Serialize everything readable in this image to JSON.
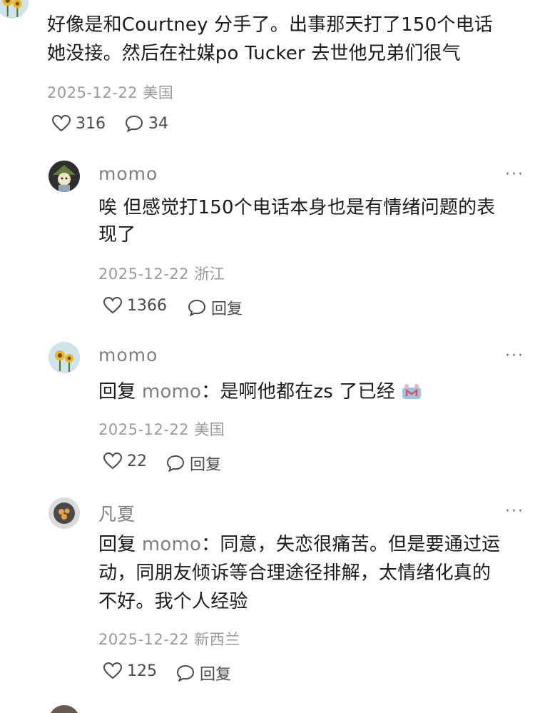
{
  "top_comment": {
    "text_line1": "好像是和Courtney 分手了。出事那天打了150个电话",
    "text_line2": "她没接。然后在社媒po Tucker 去世他兄弟们很气",
    "date": "2025-12-22",
    "location": "美国",
    "likes": "316",
    "comments": "34"
  },
  "replies": [
    {
      "name": "momo",
      "text_line1": "唉 但感觉打150个电话本身也是有情绪问题的表",
      "text_line2": "现了",
      "date": "2025-12-22",
      "location": "浙江",
      "likes": "1366",
      "reply_label": "回复",
      "more": "···"
    },
    {
      "name": "momo",
      "reply_prefix": "回复 ",
      "mention": "momo",
      "text_line1": "：是啊他都在zs 了已经",
      "date": "2025-12-22",
      "location": "美国",
      "likes": "22",
      "reply_label": "回复",
      "more": "···"
    },
    {
      "name": "凡夏",
      "reply_prefix": "回复 ",
      "mention": "momo",
      "text_line1": "：同意，失恋很痛苦。但是要通过运",
      "text_line2": "动，同朋友倾诉等合理途径排解，太情绪化真的",
      "text_line3": "不好。我个人经验",
      "date": "2025-12-22",
      "location": "新西兰",
      "likes": "125",
      "reply_label": "回复",
      "more": "···"
    }
  ],
  "colors": {
    "text": "#1b1b1b",
    "name": "#7f7f7f",
    "meta": "#9a9a9a"
  }
}
